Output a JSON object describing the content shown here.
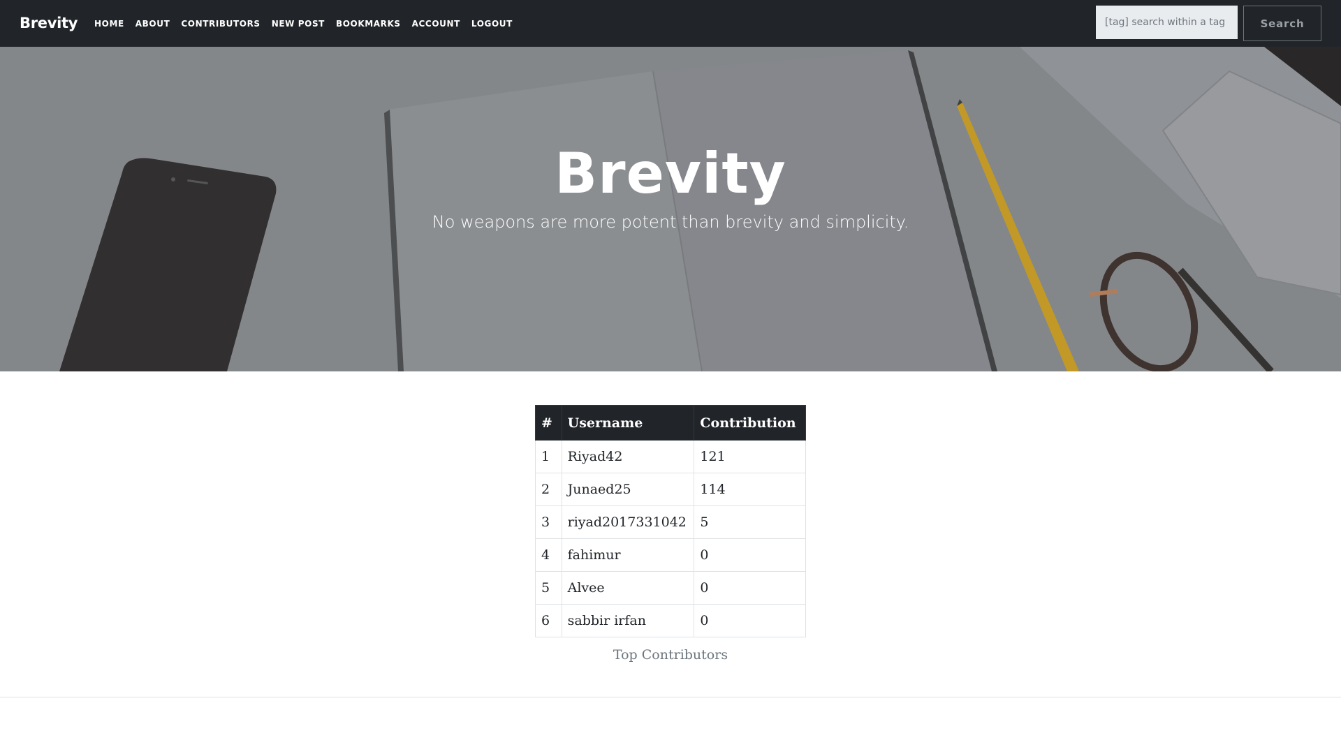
{
  "navbar": {
    "brand": "Brevity",
    "links": [
      "Home",
      "About",
      "Contributors",
      "New Post",
      "Bookmarks",
      "Account",
      "Logout"
    ],
    "search_placeholder": "[tag] search within a tag",
    "search_button": "Search"
  },
  "hero": {
    "title": "Brevity",
    "subtitle": "No weapons are more potent than brevity and simplicity."
  },
  "contributors": {
    "headers": [
      "#",
      "Username",
      "Contribution"
    ],
    "rows": [
      [
        "1",
        "Riyad42",
        "121"
      ],
      [
        "2",
        "Junaed25",
        "114"
      ],
      [
        "3",
        "riyad2017331042",
        "5"
      ],
      [
        "4",
        "fahimur",
        "0"
      ],
      [
        "5",
        "Alvee",
        "0"
      ],
      [
        "6",
        "sabbir irfan",
        "0"
      ]
    ],
    "caption": "Top Contributors"
  },
  "colors": {
    "navbar_bg": "#212529",
    "table_header_bg": "#212529",
    "hero_overlay": "#8d8f94"
  }
}
